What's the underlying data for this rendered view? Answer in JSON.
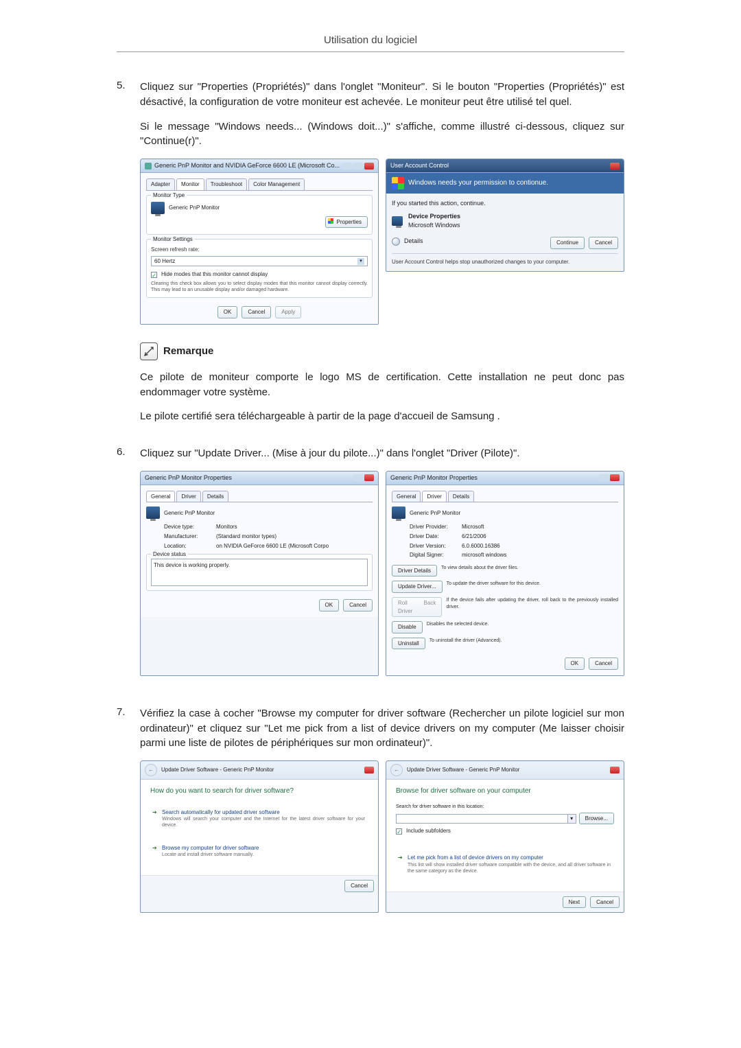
{
  "page_header": "Utilisation du logiciel",
  "step5": {
    "num": "5.",
    "p1": "Cliquez sur \"Properties (Propriétés)\" dans l'onglet \"Moniteur\". Si le bouton \"Properties (Propriétés)\" est désactivé, la configuration de votre moniteur est achevée. Le moniteur peut être utilisé tel quel.",
    "p2": "Si le message \"Windows needs... (Windows doit...)\" s'affiche, comme illustré ci-dessous, cliquez sur \"Continue(r)\"."
  },
  "monitor_dialog": {
    "title": "Generic PnP Monitor and NVIDIA GeForce 6600 LE (Microsoft Co...",
    "tabs": {
      "adapter": "Adapter",
      "monitor": "Monitor",
      "troubleshoot": "Troubleshoot",
      "color": "Color Management"
    },
    "monitor_type_legend": "Monitor Type",
    "monitor_name": "Generic PnP Monitor",
    "properties_btn": "Properties",
    "settings_legend": "Monitor Settings",
    "refresh_label": "Screen refresh rate:",
    "refresh_value": "60 Hertz",
    "hide_modes": "Hide modes that this monitor cannot display",
    "hide_note": "Clearing this check box allows you to select display modes that this monitor cannot display correctly. This may lead to an unusable display and/or damaged hardware.",
    "ok": "OK",
    "cancel": "Cancel",
    "apply": "Apply"
  },
  "uac_dialog": {
    "title": "User Account Control",
    "banner": "Windows needs your permission to contionue.",
    "started": "If you started this action, continue.",
    "prog_name": "Device Properties",
    "prog_pub": "Microsoft Windows",
    "details": "Details",
    "continue": "Continue",
    "cancel": "Cancel",
    "note": "User Account Control helps stop unauthorized changes to your computer."
  },
  "remark": {
    "label": "Remarque",
    "p1": "Ce pilote de moniteur comporte le logo MS de certification. Cette installation ne peut donc pas endommager votre système.",
    "p2": "Le pilote certifié sera téléchargeable à partir de la page d'accueil de Samsung ."
  },
  "step6": {
    "num": "6.",
    "p1": "Cliquez sur \"Update Driver... (Mise à jour du pilote...)\" dans l'onglet \"Driver (Pilote)\"."
  },
  "props_general": {
    "title": "Generic PnP Monitor Properties",
    "tabs": {
      "general": "General",
      "driver": "Driver",
      "details": "Details"
    },
    "name": "Generic PnP Monitor",
    "device_type_l": "Device type:",
    "device_type_v": "Monitors",
    "manu_l": "Manufacturer:",
    "manu_v": "(Standard monitor types)",
    "loc_l": "Location:",
    "loc_v": "on NVIDIA GeForce 6600 LE (Microsoft Corpo",
    "status_legend": "Device status",
    "status_text": "This device is working properly.",
    "ok": "OK",
    "cancel": "Cancel"
  },
  "props_driver": {
    "title": "Generic PnP Monitor Properties",
    "name": "Generic PnP Monitor",
    "provider_l": "Driver Provider:",
    "provider_v": "Microsoft",
    "date_l": "Driver Date:",
    "date_v": "6/21/2006",
    "version_l": "Driver Version:",
    "version_v": "6.0.6000.16386",
    "signer_l": "Digital Signer:",
    "signer_v": "microsoft windows",
    "btn_details": "Driver Details",
    "desc_details": "To view details about the driver files.",
    "btn_update": "Update Driver...",
    "desc_update": "To update the driver software for this device.",
    "btn_rollback": "Roll Back Driver",
    "desc_rollback": "If the device fails after updating the driver, roll back to the previously installed driver.",
    "btn_disable": "Disable",
    "desc_disable": "Disables the selected device.",
    "btn_uninstall": "Uninstall",
    "desc_uninstall": "To uninstall the driver (Advanced).",
    "ok": "OK",
    "cancel": "Cancel"
  },
  "step7": {
    "num": "7.",
    "p1": "Vérifiez la case à cocher \"Browse my computer for driver software (Rechercher un pilote logiciel sur mon ordinateur)\" et cliquez sur \"Let me pick from a list of device drivers on my computer (Me laisser choisir parmi une liste de pilotes de périphériques sur mon ordinateur)\"."
  },
  "wizard1": {
    "bc": "Update Driver Software - Generic PnP Monitor",
    "q": "How do you want to search for driver software?",
    "opt1_t": "Search automatically for updated driver software",
    "opt1_s": "Windows will search your computer and the Internet for the latest driver software for your device.",
    "opt2_t": "Browse my computer for driver software",
    "opt2_s": "Locate and install driver software manually.",
    "cancel": "Cancel"
  },
  "wizard2": {
    "bc": "Update Driver Software - Generic PnP Monitor",
    "q": "Browse for driver software on your computer",
    "loc_label": "Search for driver software in this location:",
    "browse": "Browse...",
    "include": "Include subfolders",
    "pick_t": "Let me pick from a list of device drivers on my computer",
    "pick_s": "This list will show installed driver software compatible with the device, and all driver software in the same category as the device.",
    "next": "Next",
    "cancel": "Cancel"
  }
}
